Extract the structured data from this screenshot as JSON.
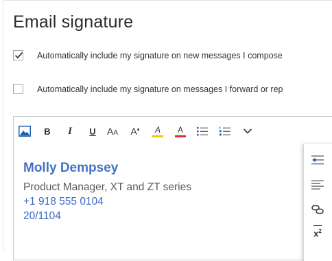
{
  "title": "Email signature",
  "options": [
    {
      "label": "Automatically include my signature on new messages I compose",
      "checked": true
    },
    {
      "label": "Automatically include my signature on messages I forward or rep",
      "checked": false
    }
  ],
  "toolbar": {
    "bold": "B",
    "italic": "I",
    "underline": "U",
    "grow_font": "A",
    "grow_font_small": "A",
    "superscript_font": "A",
    "highlight_letter": "A",
    "font_color_letter": "A",
    "accent_highlight": "#f2c600",
    "accent_font_color": "#e03030"
  },
  "signature": {
    "name": "Molly Dempsey",
    "role": "Product Manager, XT and ZT series",
    "phone": "+1 918 555 0104",
    "office": "20/1104"
  },
  "overflow_menu": {
    "items": [
      "decrease-indent-icon",
      "align-left-icon",
      "link-icon",
      "superscript-icon"
    ],
    "superscript_text": "x",
    "superscript_sup": "2"
  }
}
